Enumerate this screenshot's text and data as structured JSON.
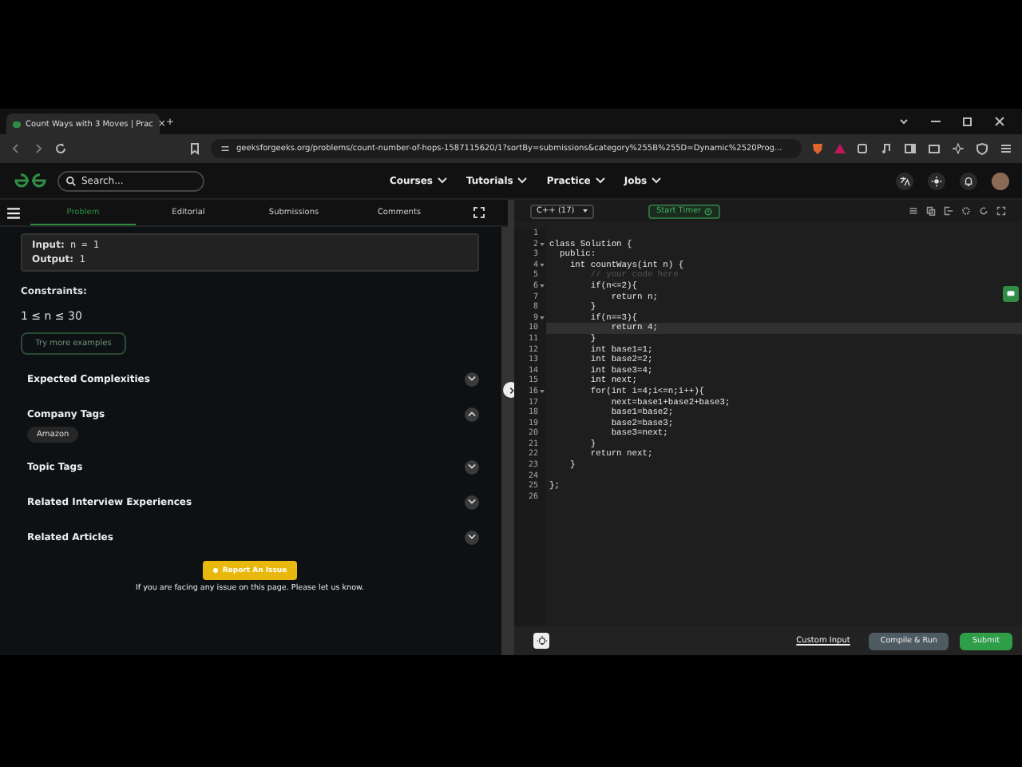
{
  "browser": {
    "tab_title": "Count Ways with 3 Moves | Prac",
    "tab_close": "×",
    "new_tab": "+",
    "url": "geeksforgeeks.org/problems/count-number-of-hops-1587115620/1?sortBy=submissions&category%255B%255D=Dynamic%2520Prog..."
  },
  "header": {
    "search": {
      "placeholder": "Search..."
    },
    "nav": [
      "Courses",
      "Tutorials",
      "Practice",
      "Jobs"
    ]
  },
  "problem_tabs": [
    {
      "label": "Problem",
      "selected": true
    },
    {
      "label": "Editorial",
      "selected": false
    },
    {
      "label": "Submissions",
      "selected": false
    },
    {
      "label": "Comments",
      "selected": false
    }
  ],
  "example": [
    "**Input:** n = 1",
    "**Output:** 1"
  ],
  "constraints": {
    "title": "Constraints:",
    "text": "1 ≤ n ≤ 30"
  },
  "try_button": "Try more examples",
  "sections": [
    {
      "title": "Expected Complexities",
      "expanded": false
    },
    {
      "title": "Company Tags",
      "expanded": true,
      "tags": [
        "Amazon"
      ]
    },
    {
      "title": "Topic Tags",
      "expanded": false
    },
    {
      "title": "Related Interview Experiences",
      "expanded": false
    },
    {
      "title": "Related Articles",
      "expanded": false
    }
  ],
  "report": {
    "button": "Report An Issue",
    "note": "If you are facing any issue on this page. Please let us know."
  },
  "editor": {
    "language": "C++ (17)",
    "timer": "Start Timer",
    "lines": [
      {
        "no": "1",
        "foldable": false,
        "active": false
      },
      {
        "no": "2",
        "text": "class Solution {",
        "kind": "code",
        "foldable": true,
        "active": false
      },
      {
        "no": "3",
        "text": "  public:",
        "kind": "code",
        "foldable": false,
        "active": false
      },
      {
        "no": "4",
        "text": "    int countWays(int n) {",
        "kind": "code",
        "foldable": true,
        "active": false
      },
      {
        "no": "5",
        "text": "        // your code here",
        "kind": "comment",
        "foldable": false,
        "active": false
      },
      {
        "no": "6",
        "text": "        if(n<=2){",
        "kind": "code",
        "foldable": true,
        "active": false
      },
      {
        "no": "7",
        "text": "            return n;",
        "kind": "code",
        "foldable": false,
        "active": false
      },
      {
        "no": "8",
        "text": "        }",
        "kind": "code",
        "foldable": false,
        "active": false
      },
      {
        "no": "9",
        "text": "        if(n==3){",
        "kind": "code",
        "foldable": true,
        "active": false
      },
      {
        "no": "10",
        "text": "            return 4;",
        "kind": "code",
        "foldable": false,
        "active": true
      },
      {
        "no": "11",
        "text": "        }",
        "kind": "code",
        "foldable": false,
        "active": false
      },
      {
        "no": "12",
        "text": "        int base1=1;",
        "kind": "code",
        "foldable": false,
        "active": false
      },
      {
        "no": "13",
        "text": "        int base2=2;",
        "kind": "code",
        "foldable": false,
        "active": false
      },
      {
        "no": "14",
        "text": "        int base3=4;",
        "kind": "code",
        "foldable": false,
        "active": false
      },
      {
        "no": "15",
        "text": "        int next;",
        "kind": "code",
        "foldable": false,
        "active": false
      },
      {
        "no": "16",
        "text": "        for(int i=4;i<=n;i++){",
        "kind": "code",
        "foldable": true,
        "active": false
      },
      {
        "no": "17",
        "text": "            next=base1+base2+base3;",
        "kind": "code",
        "foldable": false,
        "active": false
      },
      {
        "no": "18",
        "text": "            base1=base2;",
        "kind": "code",
        "foldable": false,
        "active": false
      },
      {
        "no": "19",
        "text": "            base2=base3;",
        "kind": "code",
        "foldable": false,
        "active": false
      },
      {
        "no": "20",
        "text": "            base3=next;",
        "kind": "code",
        "foldable": false,
        "active": false
      },
      {
        "no": "21",
        "text": "        }",
        "kind": "code",
        "foldable": false,
        "active": false
      },
      {
        "no": "22",
        "text": "        return next;",
        "kind": "code",
        "foldable": false,
        "active": false
      },
      {
        "no": "23",
        "text": "    }",
        "kind": "code",
        "foldable": false,
        "active": false
      },
      {
        "no": "24",
        "foldable": false,
        "active": false
      },
      {
        "no": "25",
        "text": "};",
        "kind": "code",
        "foldable": false,
        "active": false
      },
      {
        "no": "26",
        "foldable": false,
        "active": false
      }
    ],
    "custom_input": "Custom Input",
    "compile": "Compile & Run",
    "submit": "Submit"
  }
}
